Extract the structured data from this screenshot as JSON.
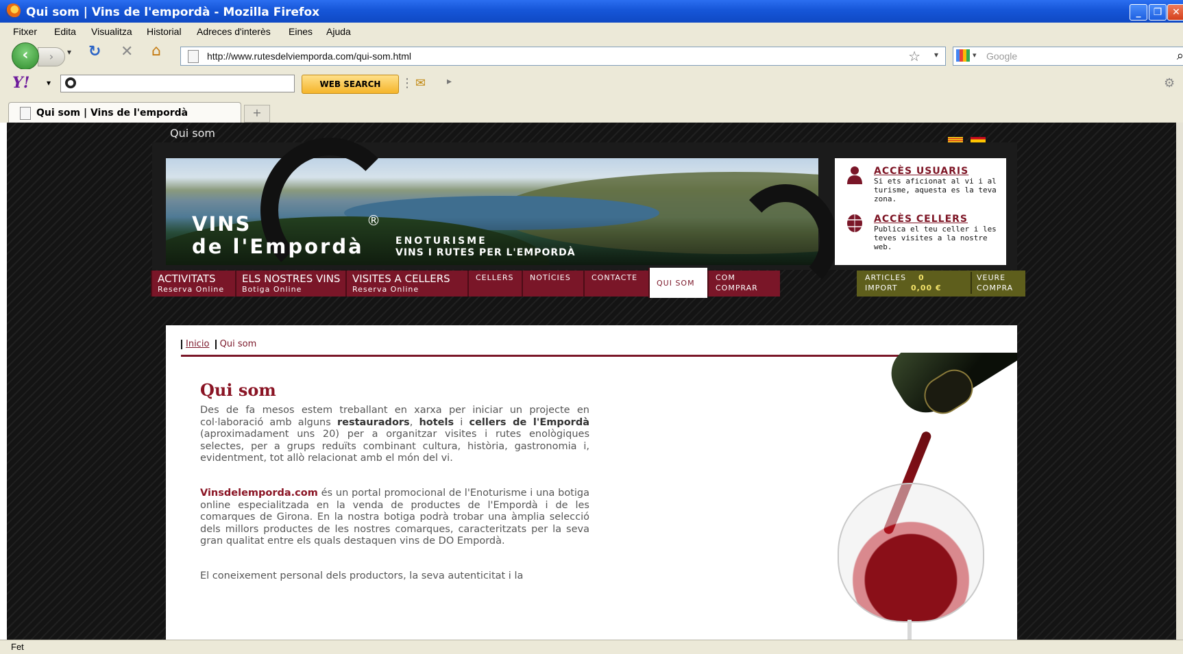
{
  "window": {
    "title": "Qui som | Vins de l'empordà - Mozilla Firefox",
    "buttons": [
      "_",
      "❐",
      "✕"
    ]
  },
  "menubar": [
    "Fitxer",
    "Edita",
    "Visualitza",
    "Historial",
    "Adreces d'interès",
    "Eines",
    "Ajuda"
  ],
  "navbar": {
    "url": "http://www.rutesdelviemporda.com/qui-som.html",
    "search_placeholder": "Google"
  },
  "yahoo_toolbar": {
    "logo": "Y!",
    "search_button": "WEB SEARCH"
  },
  "tabs": [
    {
      "label": "Qui som | Vins de l'empordà",
      "active": true
    }
  ],
  "status": "Fet",
  "page": {
    "heading": "Qui som",
    "logo_line1": "VINS",
    "logo_line2": "de l'Empordà",
    "registered": "®",
    "tagline1": "ENOTURISME",
    "tagline2": "VINS I RUTES PER L'EMPORDÀ",
    "access": [
      {
        "title": "ACCÈS USUARIS",
        "text": "Si ets aficionat al vi i al turisme, aquesta es la teva zona."
      },
      {
        "title": "ACCÈS CELLERS",
        "text": "Publica el teu celler i les teves visites a la nostre web."
      }
    ],
    "nav": [
      {
        "label": "ACTIVITATS",
        "sub": "Reserva Online"
      },
      {
        "label": "ELS NOSTRES VINS",
        "sub": "Botiga Online"
      },
      {
        "label": "VISITES A CELLERS",
        "sub": "Reserva Online"
      },
      {
        "label": "CELLERS"
      },
      {
        "label": "NOTÍCIES"
      },
      {
        "label": "CONTACTE"
      },
      {
        "label": "QUI SOM",
        "active": true
      },
      {
        "label": "COM",
        "sub": "COMPRAR"
      }
    ],
    "cart": {
      "articles_label": "ARTICLES",
      "articles_value": "0",
      "import_label": "IMPORT",
      "import_value": "0,00 €",
      "view_label1": "VEURE",
      "view_label2": "COMPRA"
    },
    "breadcrumb": {
      "home": "Inicio",
      "current": "Qui som"
    },
    "title": "Qui som",
    "p1": {
      "a": "Des de fa mesos estem treballant en xarxa per iniciar un projecte en col·laboració amb alguns ",
      "b1": "restauradors",
      "c": ", ",
      "b2": "hotels",
      "d": " i ",
      "b3": "cellers de l'Empordà",
      "e": " (aproximadament uns 20) per a organitzar visites i rutes enològiques selectes, per a grups reduïts combinant cultura, història, gastronomia i, evidentment, tot allò relacionat amb el món del vi."
    },
    "p2": {
      "brand": "Vinsdelemporda.com",
      "text": " és un portal promocional de l'Enoturisme i una botiga online especialitzada en la venda de productes de l'Empordà i de les comarques de Girona. En la nostra botiga podrà trobar una àmplia selecció dels millors productes de les nostres comarques, caracteritzats per la seva gran qualitat entre els quals destaquen vins de DO Empordà."
    },
    "p3": "El coneixement personal dels productors, la seva autenticitat i la"
  },
  "colors": {
    "brand": "#7a1628",
    "cart_bg": "#5e5e1c",
    "page_bg": "#141414"
  }
}
